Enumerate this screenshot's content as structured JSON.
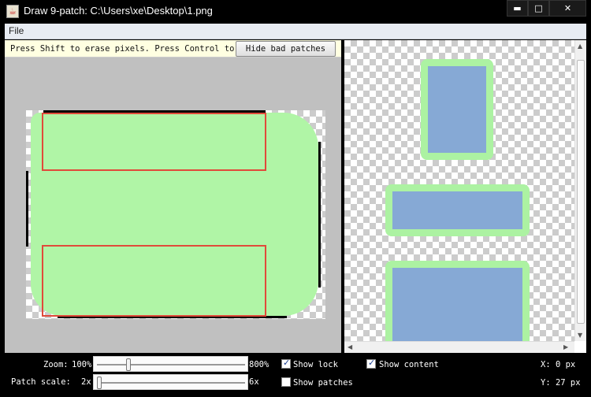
{
  "window": {
    "title": "Draw 9-patch: C:\\Users\\xe\\Desktop\\1.png",
    "minimize": "▬",
    "maximize": "□",
    "close": "✕"
  },
  "menu": {
    "file": "File"
  },
  "editor": {
    "hint": "Press Shift to erase pixels. Press Control to draw layout bounds.",
    "hide_button": "Hide bad patches"
  },
  "controls": {
    "zoom_label": "Zoom:",
    "zoom_min": "100%",
    "zoom_max": "800%",
    "zoom_value": 0.2,
    "patch_scale_label": "Patch scale:",
    "patch_scale_min": "2x",
    "patch_scale_max": "6x",
    "patch_scale_value": 0.0,
    "show_lock": {
      "label": "Show lock",
      "checked": true
    },
    "show_content": {
      "label": "Show content",
      "checked": true
    },
    "show_patches": {
      "label": "Show patches",
      "checked": false
    },
    "x_readout": "X:  0 px",
    "y_readout": "Y: 27 px"
  },
  "colors": {
    "patch_fill": "#b0f5a6",
    "patch_outline": "#e04a3a",
    "preview_content": "#86a9d5",
    "preview_border": "#acf2a2"
  }
}
